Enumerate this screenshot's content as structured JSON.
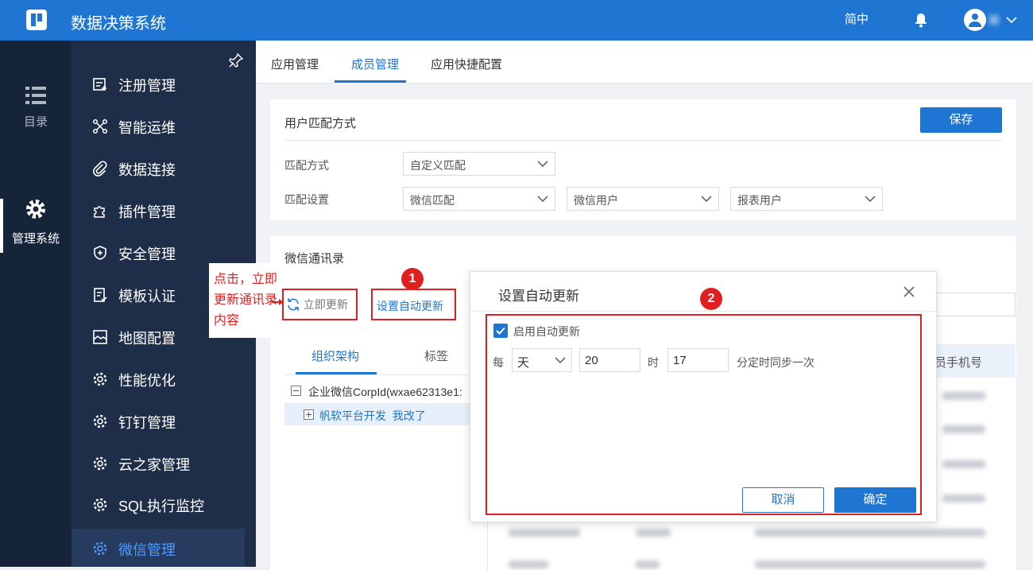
{
  "header": {
    "title": "数据决策系统",
    "lang": "简中"
  },
  "rail": {
    "items": [
      {
        "label": "目录"
      },
      {
        "label": "管理系统"
      }
    ]
  },
  "menu": {
    "items": [
      {
        "label": "注册管理",
        "icon": "register-icon"
      },
      {
        "label": "智能运维",
        "icon": "ops-icon"
      },
      {
        "label": "数据连接",
        "icon": "link-icon"
      },
      {
        "label": "插件管理",
        "icon": "plugin-icon"
      },
      {
        "label": "安全管理",
        "icon": "shield-icon"
      },
      {
        "label": "模板认证",
        "icon": "template-icon"
      },
      {
        "label": "地图配置",
        "icon": "map-icon"
      },
      {
        "label": "性能优化",
        "icon": "gear-icon"
      },
      {
        "label": "钉钉管理",
        "icon": "gear-icon"
      },
      {
        "label": "云之家管理",
        "icon": "gear-icon"
      },
      {
        "label": "SQL执行监控",
        "icon": "gear-icon"
      },
      {
        "label": "微信管理",
        "icon": "gear-icon",
        "active": true
      }
    ]
  },
  "tabs": [
    {
      "label": "应用管理"
    },
    {
      "label": "成员管理",
      "active": true
    },
    {
      "label": "应用快捷配置"
    }
  ],
  "match": {
    "title": "用户匹配方式",
    "save": "保存",
    "mode_label": "匹配方式",
    "mode_value": "自定义匹配",
    "setting_label": "匹配设置",
    "setting_values": [
      "微信匹配",
      "微信用户",
      "报表用户"
    ]
  },
  "contacts": {
    "title": "微信通讯录",
    "refresh": "立即更新",
    "auto_update": "设置自动更新",
    "subtabs": [
      "组织架构",
      "标签"
    ],
    "tree_root": "企业微信CorpId(wxae62313e1:",
    "tree_child": "帆软平台开发  我改了",
    "col_phone": "员手机号"
  },
  "annotation": {
    "text": "点击，立即更新通讯录内容",
    "badges": [
      "1",
      "2"
    ]
  },
  "dialog": {
    "title": "设置自动更新",
    "enable_label": "启用自动更新",
    "every": "每",
    "unit": "天",
    "hour_value": "20",
    "hour_label": "时",
    "minute_value": "17",
    "minute_label": "分定时同步一次",
    "cancel": "取消",
    "confirm": "确定"
  },
  "colors": {
    "primary": "#1f76d2",
    "sidebar": "#1e2e48",
    "rail": "#16243a",
    "annotation": "#e02020"
  }
}
